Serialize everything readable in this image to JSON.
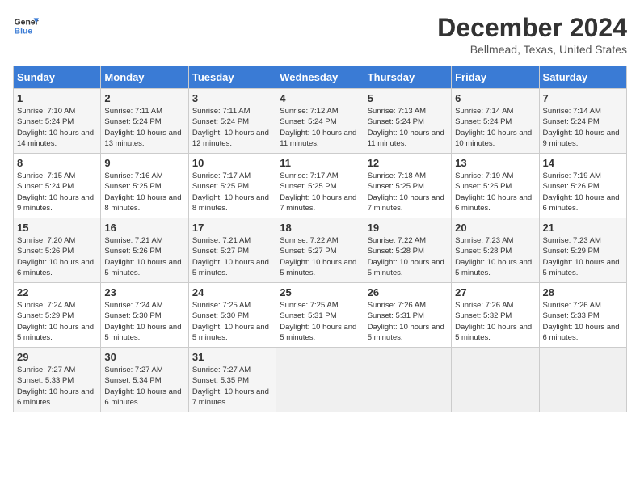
{
  "header": {
    "logo_line1": "General",
    "logo_line2": "Blue",
    "title": "December 2024",
    "subtitle": "Bellmead, Texas, United States"
  },
  "weekdays": [
    "Sunday",
    "Monday",
    "Tuesday",
    "Wednesday",
    "Thursday",
    "Friday",
    "Saturday"
  ],
  "weeks": [
    [
      {
        "day": "1",
        "info": "Sunrise: 7:10 AM\nSunset: 5:24 PM\nDaylight: 10 hours and 14 minutes."
      },
      {
        "day": "2",
        "info": "Sunrise: 7:11 AM\nSunset: 5:24 PM\nDaylight: 10 hours and 13 minutes."
      },
      {
        "day": "3",
        "info": "Sunrise: 7:11 AM\nSunset: 5:24 PM\nDaylight: 10 hours and 12 minutes."
      },
      {
        "day": "4",
        "info": "Sunrise: 7:12 AM\nSunset: 5:24 PM\nDaylight: 10 hours and 11 minutes."
      },
      {
        "day": "5",
        "info": "Sunrise: 7:13 AM\nSunset: 5:24 PM\nDaylight: 10 hours and 11 minutes."
      },
      {
        "day": "6",
        "info": "Sunrise: 7:14 AM\nSunset: 5:24 PM\nDaylight: 10 hours and 10 minutes."
      },
      {
        "day": "7",
        "info": "Sunrise: 7:14 AM\nSunset: 5:24 PM\nDaylight: 10 hours and 9 minutes."
      }
    ],
    [
      {
        "day": "8",
        "info": "Sunrise: 7:15 AM\nSunset: 5:24 PM\nDaylight: 10 hours and 9 minutes."
      },
      {
        "day": "9",
        "info": "Sunrise: 7:16 AM\nSunset: 5:25 PM\nDaylight: 10 hours and 8 minutes."
      },
      {
        "day": "10",
        "info": "Sunrise: 7:17 AM\nSunset: 5:25 PM\nDaylight: 10 hours and 8 minutes."
      },
      {
        "day": "11",
        "info": "Sunrise: 7:17 AM\nSunset: 5:25 PM\nDaylight: 10 hours and 7 minutes."
      },
      {
        "day": "12",
        "info": "Sunrise: 7:18 AM\nSunset: 5:25 PM\nDaylight: 10 hours and 7 minutes."
      },
      {
        "day": "13",
        "info": "Sunrise: 7:19 AM\nSunset: 5:25 PM\nDaylight: 10 hours and 6 minutes."
      },
      {
        "day": "14",
        "info": "Sunrise: 7:19 AM\nSunset: 5:26 PM\nDaylight: 10 hours and 6 minutes."
      }
    ],
    [
      {
        "day": "15",
        "info": "Sunrise: 7:20 AM\nSunset: 5:26 PM\nDaylight: 10 hours and 6 minutes."
      },
      {
        "day": "16",
        "info": "Sunrise: 7:21 AM\nSunset: 5:26 PM\nDaylight: 10 hours and 5 minutes."
      },
      {
        "day": "17",
        "info": "Sunrise: 7:21 AM\nSunset: 5:27 PM\nDaylight: 10 hours and 5 minutes."
      },
      {
        "day": "18",
        "info": "Sunrise: 7:22 AM\nSunset: 5:27 PM\nDaylight: 10 hours and 5 minutes."
      },
      {
        "day": "19",
        "info": "Sunrise: 7:22 AM\nSunset: 5:28 PM\nDaylight: 10 hours and 5 minutes."
      },
      {
        "day": "20",
        "info": "Sunrise: 7:23 AM\nSunset: 5:28 PM\nDaylight: 10 hours and 5 minutes."
      },
      {
        "day": "21",
        "info": "Sunrise: 7:23 AM\nSunset: 5:29 PM\nDaylight: 10 hours and 5 minutes."
      }
    ],
    [
      {
        "day": "22",
        "info": "Sunrise: 7:24 AM\nSunset: 5:29 PM\nDaylight: 10 hours and 5 minutes."
      },
      {
        "day": "23",
        "info": "Sunrise: 7:24 AM\nSunset: 5:30 PM\nDaylight: 10 hours and 5 minutes."
      },
      {
        "day": "24",
        "info": "Sunrise: 7:25 AM\nSunset: 5:30 PM\nDaylight: 10 hours and 5 minutes."
      },
      {
        "day": "25",
        "info": "Sunrise: 7:25 AM\nSunset: 5:31 PM\nDaylight: 10 hours and 5 minutes."
      },
      {
        "day": "26",
        "info": "Sunrise: 7:26 AM\nSunset: 5:31 PM\nDaylight: 10 hours and 5 minutes."
      },
      {
        "day": "27",
        "info": "Sunrise: 7:26 AM\nSunset: 5:32 PM\nDaylight: 10 hours and 5 minutes."
      },
      {
        "day": "28",
        "info": "Sunrise: 7:26 AM\nSunset: 5:33 PM\nDaylight: 10 hours and 6 minutes."
      }
    ],
    [
      {
        "day": "29",
        "info": "Sunrise: 7:27 AM\nSunset: 5:33 PM\nDaylight: 10 hours and 6 minutes."
      },
      {
        "day": "30",
        "info": "Sunrise: 7:27 AM\nSunset: 5:34 PM\nDaylight: 10 hours and 6 minutes."
      },
      {
        "day": "31",
        "info": "Sunrise: 7:27 AM\nSunset: 5:35 PM\nDaylight: 10 hours and 7 minutes."
      },
      {
        "day": "",
        "info": ""
      },
      {
        "day": "",
        "info": ""
      },
      {
        "day": "",
        "info": ""
      },
      {
        "day": "",
        "info": ""
      }
    ]
  ]
}
